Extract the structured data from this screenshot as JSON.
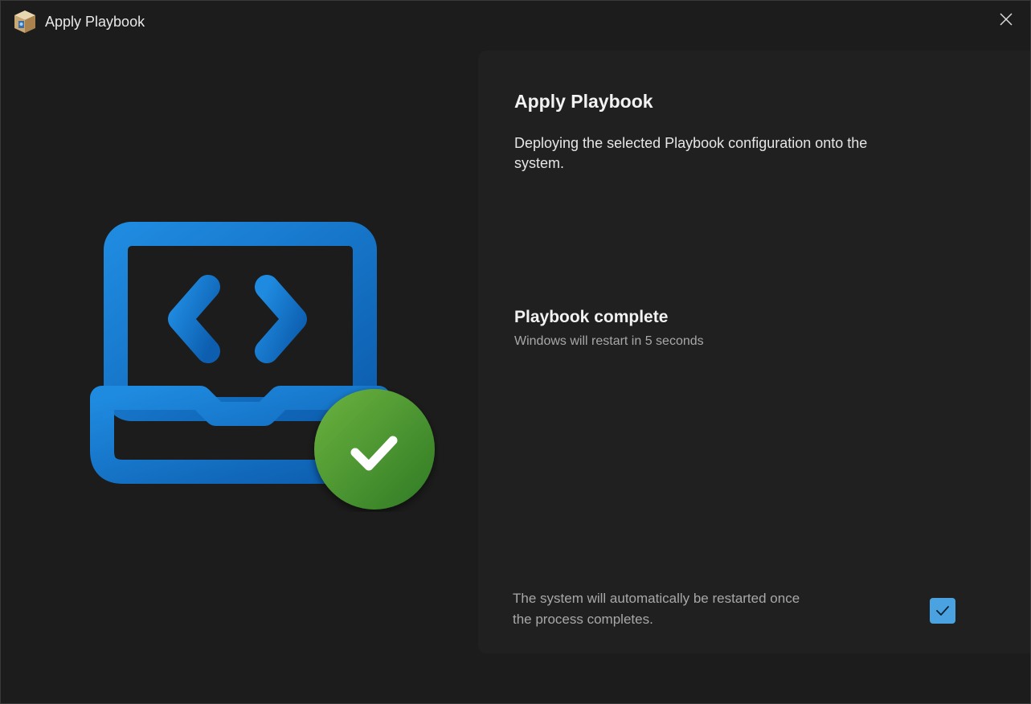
{
  "window": {
    "title": "Apply Playbook",
    "app_icon": "cube-app-icon",
    "close_icon": "close-icon"
  },
  "illustration": {
    "icon": "laptop-code-icon",
    "badge_icon": "checkmark-circle-icon",
    "colors": {
      "laptop": "#1878d0",
      "badge": "#4a9a30",
      "check": "#ffffff"
    }
  },
  "main": {
    "heading": "Apply Playbook",
    "description": "Deploying the selected Playbook configuration onto the system.",
    "status_title": "Playbook complete",
    "status_subtitle": "Windows will restart in 5 seconds",
    "restart_note": "The system will automatically be restarted once the process completes.",
    "auto_restart_checked": true
  },
  "colors": {
    "background": "#1c1c1c",
    "card": "#202020",
    "accent": "#4aa3e0"
  }
}
